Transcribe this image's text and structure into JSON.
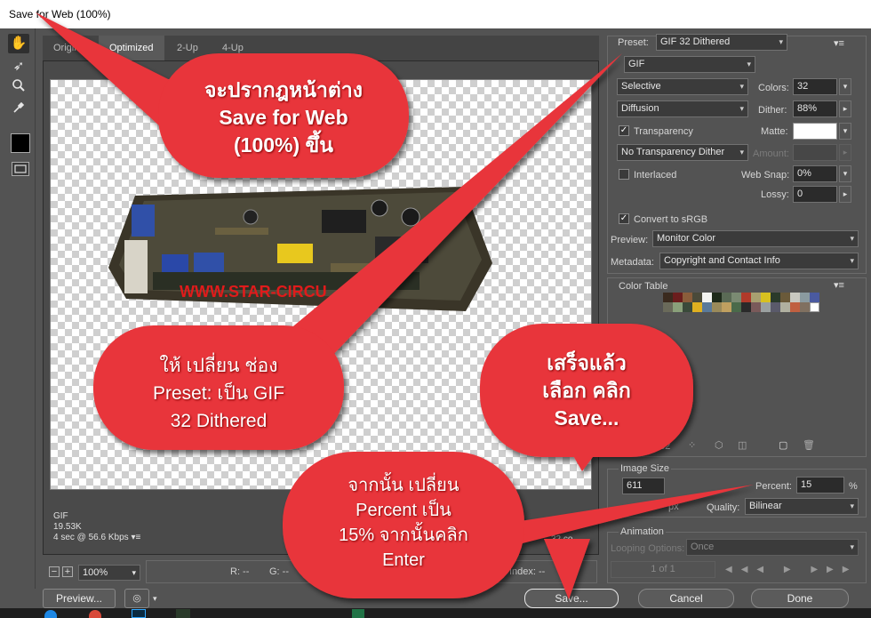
{
  "window": {
    "title": "Save for Web (100%)"
  },
  "tools": [
    {
      "name": "hand-tool-icon",
      "glyph": "✋"
    },
    {
      "name": "slice-select-tool-icon",
      "glyph": "➶"
    },
    {
      "name": "zoom-tool-icon",
      "glyph": "🔍"
    },
    {
      "name": "eyedropper-tool-icon",
      "glyph": "✎"
    }
  ],
  "tabs": [
    "Original",
    "Optimized",
    "2-Up",
    "4-Up"
  ],
  "active_tab": "Optimized",
  "board_text": "WWW.STAR-CIRCU",
  "image_info": {
    "format": "GIF",
    "size": "19.53K",
    "time": "4 sec @ 56.6 Kbps",
    "colors": "32 co"
  },
  "zoom": {
    "value": "100%",
    "minus": "−",
    "plus": "+"
  },
  "readout": {
    "r": "R: --",
    "g": "G: --",
    "index": "Index: --"
  },
  "settings": {
    "preset_label": "Preset:",
    "preset_value": "GIF 32 Dithered",
    "format": "GIF",
    "reduction": "Selective",
    "colors_label": "Colors:",
    "colors_value": "32",
    "dither_algo": "Diffusion",
    "dither_label": "Dither:",
    "dither_value": "88%",
    "transparency_label": "Transparency",
    "transparency_checked": true,
    "matte_label": "Matte:",
    "transparency_dither": "No Transparency Dither",
    "amount_label": "Amount:",
    "interlaced_label": "Interlaced",
    "interlaced_checked": false,
    "websnap_label": "Web Snap:",
    "websnap_value": "0%",
    "lossy_label": "Lossy:",
    "lossy_value": "0",
    "srgb_label": "Convert to sRGB",
    "srgb_checked": true,
    "preview_label": "Preview:",
    "preview_value": "Monitor Color",
    "metadata_label": "Metadata:",
    "metadata_value": "Copyright and Contact Info"
  },
  "color_table": {
    "title": "Color Table",
    "count": "32",
    "swatches": [
      "#3a2a1e",
      "#6b1d1d",
      "#8a5d3b",
      "#4a4a3a",
      "#f3f3f0",
      "#1e2a1a",
      "#5a6a55",
      "#7a8a72",
      "#b03a2a",
      "#a8a070",
      "#d8c020",
      "#2a3a2a",
      "#6a5a3a",
      "#c8c8c0",
      "#8a9aa0",
      "#4a5aa0",
      "#6a6a5a",
      "#8aa07a",
      "#3a4a3a",
      "#e0b020",
      "#5a7a9a",
      "#9a8a5a",
      "#c0a060",
      "#4a6a4a",
      "#2a2a2a",
      "#7a5a5a",
      "#9aa0a0",
      "#5a5a6a",
      "#b0b0a0",
      "#c06040",
      "#807060",
      "transparent"
    ]
  },
  "image_size": {
    "title": "Image Size",
    "percent_label": "Percent:",
    "percent_value": "15",
    "percent_unit": "%",
    "quality_label": "Quality:",
    "quality_value": "Bilinear",
    "w": "611",
    "px": "px"
  },
  "animation": {
    "title": "Animation",
    "looping_label": "Looping Options:",
    "looping_value": "Once",
    "frame": "1 of 1"
  },
  "buttons": {
    "preview": "Preview...",
    "save": "Save...",
    "cancel": "Cancel",
    "done": "Done"
  },
  "annotations": {
    "c1": [
      "จะปรากฎหน้าต่าง",
      "Save for Web",
      "(100%) ขึ้น"
    ],
    "c2": [
      "ให้ เปลี่ยน ช่อง",
      "Preset: เป็น GIF",
      "32 Dithered"
    ],
    "c3": [
      "เสร็จแล้ว",
      "เลือก คลิก",
      "Save..."
    ],
    "c4": [
      "จากนั้น เปลี่ยน",
      "Percent เป็น",
      "15% จากนั้นคลิก",
      "Enter"
    ]
  },
  "colors": {
    "callout": "#e8343a",
    "accent": "#ffffff"
  }
}
